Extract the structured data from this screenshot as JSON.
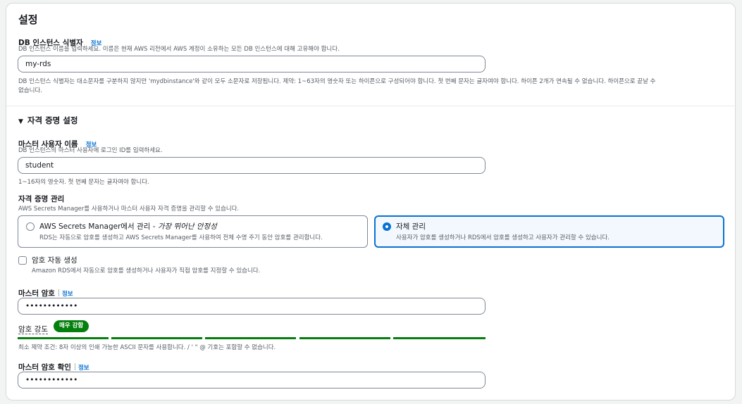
{
  "section_title": "설정",
  "db_identifier": {
    "label": "DB 인스턴스 식별자",
    "info": "정보",
    "description": "DB 인스턴스 이름을 입력하세요. 이름은 현재 AWS 리전에서 AWS 계정이 소유하는 모든 DB 인스턴스에 대해 고유해야 합니다.",
    "value": "my-rds",
    "constraint_line1": "DB 인스턴스 식별자는 대소문자를 구분하지 않지만 'mydbinstance'와 같이 모두 소문자로 저장됩니다. 제약: 1~63자의 영숫자 또는 하이픈으로 구성되어야 합니다. 첫 번째 문자는 글자여야 합니다. 하이픈 2개가 연속될 수 없습니다. 하이픈으로 끝날 수",
    "constraint_line2": "없습니다."
  },
  "credentials": {
    "title": "자격 증명 설정",
    "expand_icon": "caret-down-icon",
    "master_username": {
      "label": "마스터 사용자 이름",
      "info": "정보",
      "description": "DB 인스턴스의 마스터 사용자에 로그인 ID를 입력하세요.",
      "value": "student",
      "constraint": "1~16자의 영숫자. 첫 번째 문자는 글자여야 합니다."
    },
    "management": {
      "label": "자격 증명 관리",
      "description": "AWS Secrets Manager를 사용하거나 마스터 사용자 자격 증명을 관리할 수 있습니다.",
      "options": [
        {
          "title": "AWS Secrets Manager에서 관리 - ",
          "title_emphasis": "가장 뛰어난 안정성",
          "description": "RDS는 자동으로 암호를 생성하고 AWS Secrets Manager를 사용하여 전체 수명 주기 동안 암호를 관리합니다.",
          "selected": false
        },
        {
          "title": "자체 관리",
          "description": "사용자가 암호를 생성하거나 RDS에서 암호를 생성하고 사용자가 관리할 수 있습니다.",
          "selected": true
        }
      ]
    },
    "auto_generate": {
      "label": "암호 자동 생성",
      "description": "Amazon RDS에서 자동으로 암호를 생성하거나 사용자가 직접 암호를 지정할 수 있습니다.",
      "checked": false
    },
    "master_password": {
      "label": "마스터 암호",
      "info": "정보",
      "value": "••••••••••••",
      "strength_label": "암호 강도",
      "strength_value": "매우 강함",
      "strength_color": "#037f0c",
      "constraint": "최소 제약 조건: 8자 이상의 인쇄 가능한 ASCII 문자를 사용합니다. / ' \" @ 기호는 포함할 수 없습니다."
    },
    "confirm_password": {
      "label": "마스터 암호 확인",
      "info": "정보",
      "value": "••••••••••••"
    }
  },
  "colors": {
    "accent": "#0972d3",
    "success": "#037f0c",
    "border": "#7d8998"
  }
}
